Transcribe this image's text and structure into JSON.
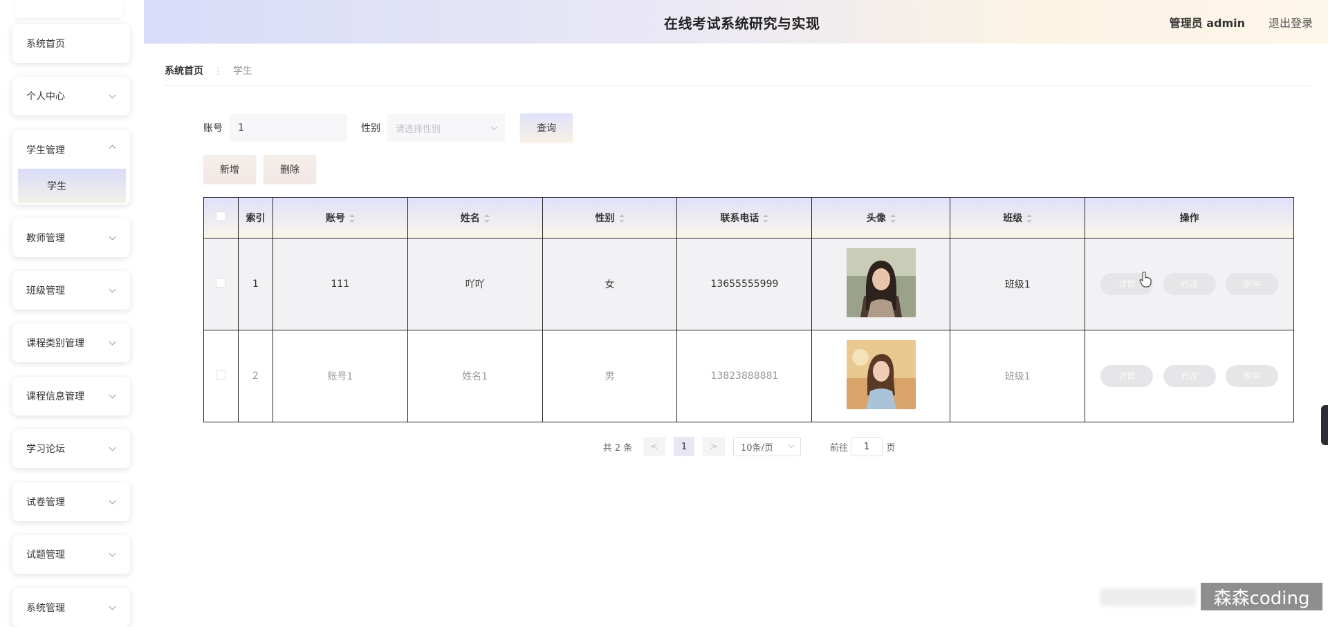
{
  "app": {
    "title": "在线考试系统研究与实现",
    "user_label": "管理员 admin",
    "logout_label": "退出登录"
  },
  "sidebar": {
    "items": [
      {
        "label": "系统首页",
        "has_arrow": false
      },
      {
        "label": "个人中心",
        "has_arrow": true
      },
      {
        "label": "学生管理",
        "has_arrow": true,
        "expanded": true,
        "children": [
          {
            "label": "学生",
            "active": true
          }
        ]
      },
      {
        "label": "教师管理",
        "has_arrow": true
      },
      {
        "label": "班级管理",
        "has_arrow": true
      },
      {
        "label": "课程类别管理",
        "has_arrow": true
      },
      {
        "label": "课程信息管理",
        "has_arrow": true
      },
      {
        "label": "学习论坛",
        "has_arrow": true
      },
      {
        "label": "试卷管理",
        "has_arrow": true
      },
      {
        "label": "试题管理",
        "has_arrow": true
      },
      {
        "label": "系统管理",
        "has_arrow": true
      }
    ]
  },
  "breadcrumb": {
    "home": "系统首页",
    "separator": "⋮",
    "current": "学生"
  },
  "search": {
    "account_label": "账号",
    "account_value": "1",
    "gender_label": "性别",
    "gender_placeholder": "请选择性别",
    "query_button": "查询"
  },
  "actions": {
    "add_button": "新增",
    "delete_button": "删除"
  },
  "table": {
    "columns": [
      "索引",
      "账号",
      "姓名",
      "性别",
      "联系电话",
      "头像",
      "班级",
      "操作"
    ],
    "rows": [
      {
        "index": "1",
        "account": "111",
        "name": "吖吖",
        "gender": "女",
        "phone": "13655555999",
        "class": "班级1",
        "avatar": "avatar-photo-1"
      },
      {
        "index": "2",
        "account": "账号1",
        "name": "姓名1",
        "gender": "男",
        "phone": "13823888881",
        "class": "班级1",
        "avatar": "avatar-photo-2"
      }
    ],
    "row_actions": {
      "detail": "详情",
      "edit": "修改",
      "delete": "删除"
    }
  },
  "pagination": {
    "total_text": "共 2 条",
    "prev": "<",
    "current_page": "1",
    "next": ">",
    "page_size": "10条/页",
    "goto_label": "前往",
    "goto_value": "1",
    "goto_suffix": "页"
  },
  "watermark": "森森coding",
  "colors": {
    "header_gradient_start": "#d8dcf9",
    "header_gradient_end": "#fdf6ea",
    "button_gradient_start": "#dfe2fa",
    "button_gradient_end": "#f7f0e4"
  }
}
